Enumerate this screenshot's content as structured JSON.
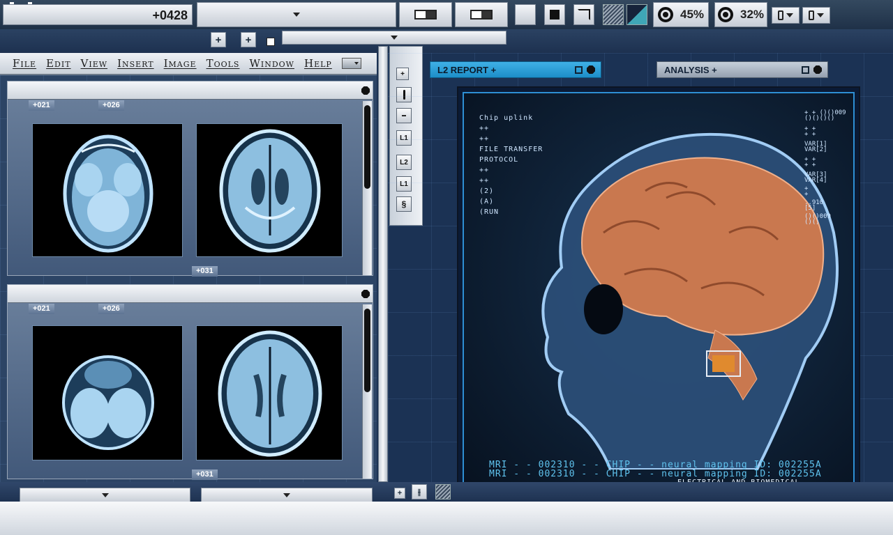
{
  "top": {
    "counter": "+0428",
    "percent1": "45%",
    "percent2": "32%"
  },
  "menu": {
    "items": [
      "File",
      "Edit",
      "View",
      "Insert",
      "Image",
      "Tools",
      "Window",
      "Help"
    ]
  },
  "panel_top": {
    "tag1": "+021",
    "tag2": "+026",
    "tag3": "+031"
  },
  "panel_bottom": {
    "tag1": "+021",
    "tag2": "+026",
    "tag3": "+031"
  },
  "toolbar": {
    "btn_plus": "+",
    "btn_l1": "L1",
    "btn_l2": "L2",
    "btn_l1b": "L1"
  },
  "tabs": {
    "report": "L2 REPORT +",
    "analysis": "ANALYSIS +"
  },
  "hud": {
    "left_lines": [
      "Chip uplink",
      "++",
      "++",
      "FILE TRANSFER",
      "PROTOCOL",
      "++",
      "++",
      "(2)",
      "(A)",
      "(RUN"
    ],
    "right_lines": [
      "+ + ()()009",
      "()()()()",
      "+ +",
      "+ +",
      "VAR[1]",
      "VAR[2]",
      "+ +",
      "+ +",
      "VAR[3]",
      "VAR[4]",
      "+",
      "+",
      "..910",
      "[5]",
      "()()009",
      "()()"
    ]
  },
  "caption": {
    "line1": "MRI - - 002310 - - CHIP - - neural mapping ID: 002255A",
    "line2": "MRI - - 002310 - - CHIP - - neural mapping ID: 002255A",
    "line3": "ELECTRICAL AND BIOMEDICAL"
  },
  "colors": {
    "accent": "#2a9fd8",
    "background": "#1b3254",
    "hud_text": "#5fc3ee"
  }
}
